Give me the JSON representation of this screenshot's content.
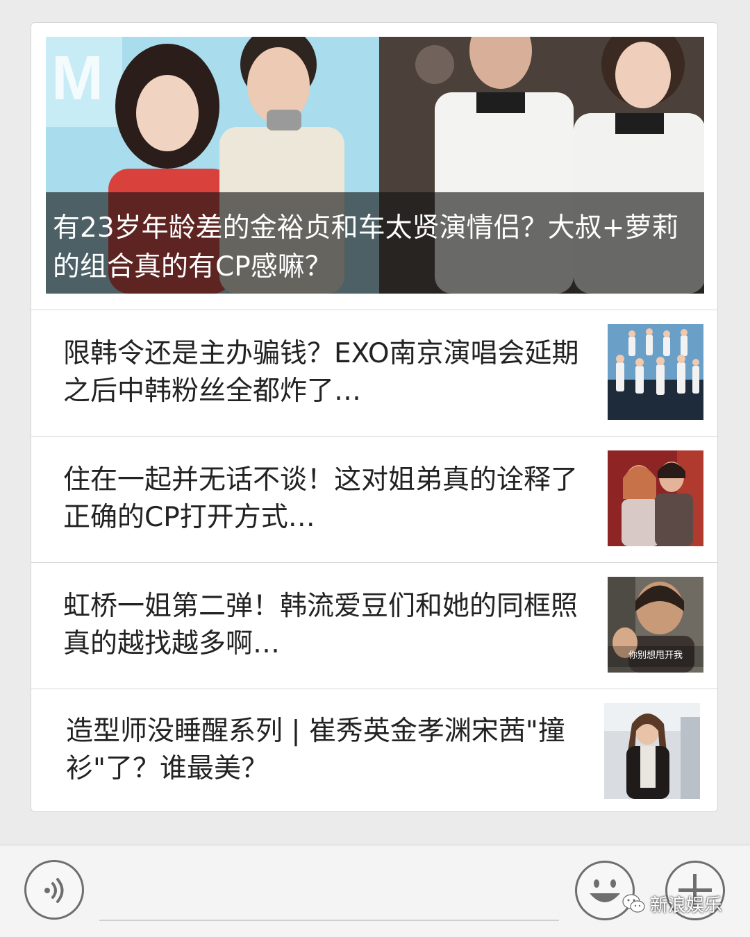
{
  "featured": {
    "title": "有23岁年龄差的金裕贞和车太贤演情侣？大叔+萝莉的组合真的有CP感嘛？"
  },
  "articles": [
    {
      "title": "限韩令还是主办骗钱？EXO南京演唱会延期之后中韩粉丝全都炸了…",
      "thumb_icon": "group-on-stage-photo"
    },
    {
      "title": "住在一起并无话不谈！这对姐弟真的诠释了正确的CP打开方式…",
      "thumb_icon": "duo-portrait-photo"
    },
    {
      "title": "虹桥一姐第二弹！韩流爱豆们和她的同框照真的越找越多啊…",
      "thumb_icon": "waving-woman-photo",
      "thumb_caption": "你别想甩开我"
    },
    {
      "title": "造型师没睡醒系列 | 崔秀英金孝渊宋茜\"撞衫\"了？谁最美？",
      "thumb_icon": "airport-fashion-photo"
    }
  ],
  "bottom_bar": {
    "voice_icon": "voice-input-icon",
    "emoji_icon": "emoji-icon",
    "plus_icon": "plus-icon"
  },
  "watermark": {
    "text": "新浪娱乐",
    "icon": "wechat-icon"
  },
  "colors": {
    "background": "#ebebeb",
    "card": "#ffffff",
    "text": "#222222",
    "caption_overlay": "rgba(20,20,20,0.62)"
  }
}
